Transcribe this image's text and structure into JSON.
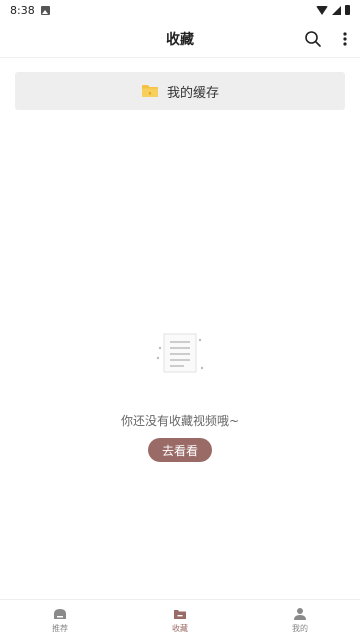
{
  "status_bar": {
    "time": "8:38"
  },
  "app_bar": {
    "title": "收藏"
  },
  "cache": {
    "label": "我的缓存"
  },
  "empty_state": {
    "message": "你还没有收藏视频哦~",
    "action_label": "去看看"
  },
  "bottom_nav": {
    "items": [
      {
        "label": "推荐",
        "icon": "home-icon",
        "active": false
      },
      {
        "label": "收藏",
        "icon": "folder-icon",
        "active": true
      },
      {
        "label": "我的",
        "icon": "person-icon",
        "active": false
      }
    ]
  },
  "colors": {
    "accent": "#9a6b66",
    "folder": "#f5c242"
  }
}
